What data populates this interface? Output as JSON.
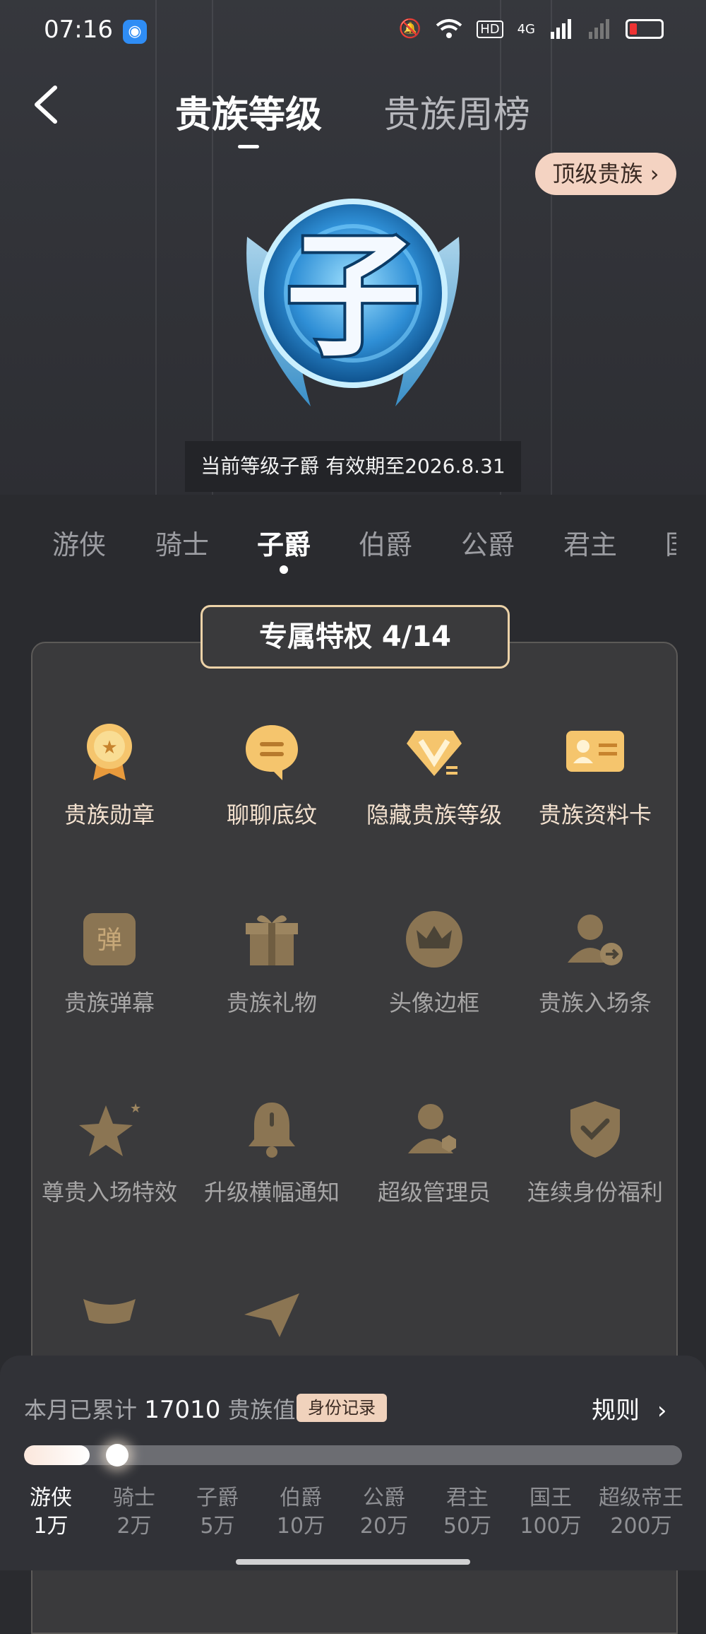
{
  "status_bar": {
    "time": "07:16",
    "app_icon": "baidu-icon",
    "network": "4G"
  },
  "header": {
    "tab_active": "贵族等级",
    "tab_inactive": "贵族周榜",
    "top_noble_button": "顶级贵族",
    "current_level_text": "当前等级子爵 有效期至2026.8.31",
    "badge_character": "子"
  },
  "level_tabs": [
    "游侠",
    "骑士",
    "子爵",
    "伯爵",
    "公爵",
    "君主",
    "国"
  ],
  "privileges": {
    "title": "专属特权 4/14",
    "items": [
      {
        "label": "贵族勋章",
        "icon": "medal-icon",
        "unlocked": true
      },
      {
        "label": "聊聊底纹",
        "icon": "chat-bubble-icon",
        "unlocked": true
      },
      {
        "label": "隐藏贵族等级",
        "icon": "v-diamond-icon",
        "unlocked": true
      },
      {
        "label": "贵族资料卡",
        "icon": "id-card-icon",
        "unlocked": true
      },
      {
        "label": "贵族弹幕",
        "icon": "danmaku-icon",
        "unlocked": false,
        "glyph": "弹"
      },
      {
        "label": "贵族礼物",
        "icon": "gift-icon",
        "unlocked": false
      },
      {
        "label": "头像边框",
        "icon": "crown-frame-icon",
        "unlocked": false
      },
      {
        "label": "贵族入场条",
        "icon": "user-enter-icon",
        "unlocked": false
      },
      {
        "label": "尊贵入场特效",
        "icon": "star-effect-icon",
        "unlocked": false
      },
      {
        "label": "升级横幅通知",
        "icon": "bell-icon",
        "unlocked": false
      },
      {
        "label": "超级管理员",
        "icon": "admin-user-icon",
        "unlocked": false
      },
      {
        "label": "连续身份福利",
        "icon": "shield-check-icon",
        "unlocked": false
      },
      {
        "label": "",
        "icon": "ingot-icon",
        "unlocked": false
      },
      {
        "label": "",
        "icon": "paper-plane-icon",
        "unlocked": false
      }
    ]
  },
  "progress": {
    "prefix": "本月已累计",
    "value": "17010",
    "suffix": "贵族值",
    "record_button": "身份记录",
    "rules_label": "规则",
    "fill_fraction": 0.1,
    "levels": [
      {
        "name": "游侠",
        "amount": "1万",
        "active": true
      },
      {
        "name": "骑士",
        "amount": "2万",
        "active": false
      },
      {
        "name": "子爵",
        "amount": "5万",
        "active": false
      },
      {
        "name": "伯爵",
        "amount": "10万",
        "active": false
      },
      {
        "name": "公爵",
        "amount": "20万",
        "active": false
      },
      {
        "name": "君主",
        "amount": "50万",
        "active": false
      },
      {
        "name": "国王",
        "amount": "100万",
        "active": false
      },
      {
        "name": "超级帝王",
        "amount": "200万",
        "active": false
      }
    ]
  }
}
